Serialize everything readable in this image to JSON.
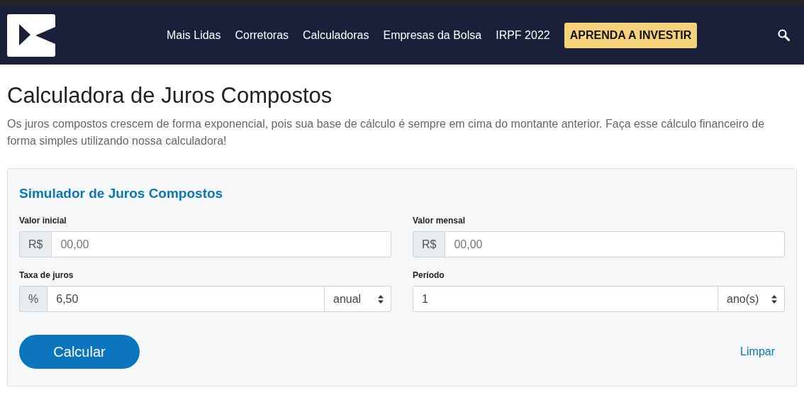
{
  "nav": {
    "items": [
      "Mais Lidas",
      "Corretoras",
      "Calculadoras",
      "Empresas da Bolsa",
      "IRPF 2022"
    ],
    "cta": "APRENDA A INVESTIR"
  },
  "page": {
    "title": "Calculadora de Juros Compostos",
    "description": "Os juros compostos crescem de forma exponencial, pois sua base de cálculo é sempre em cima do montante anterior. Faça esse cálculo financeiro de forma simples utilizando nossa calculadora!"
  },
  "simulator": {
    "title": "Simulador de Juros Compostos",
    "fields": [
      {
        "label": "Valor inicial",
        "prefix": "R$",
        "placeholder": "00,00"
      },
      {
        "label": "Valor mensal",
        "prefix": "R$",
        "placeholder": "00,00"
      },
      {
        "label": "Taxa de juros",
        "prefix": "%",
        "value": "6,50",
        "select": "anual"
      },
      {
        "label": "Período",
        "value": "1",
        "select": "ano(s)"
      }
    ],
    "submit": "Calcular",
    "reset": "Limpar"
  }
}
